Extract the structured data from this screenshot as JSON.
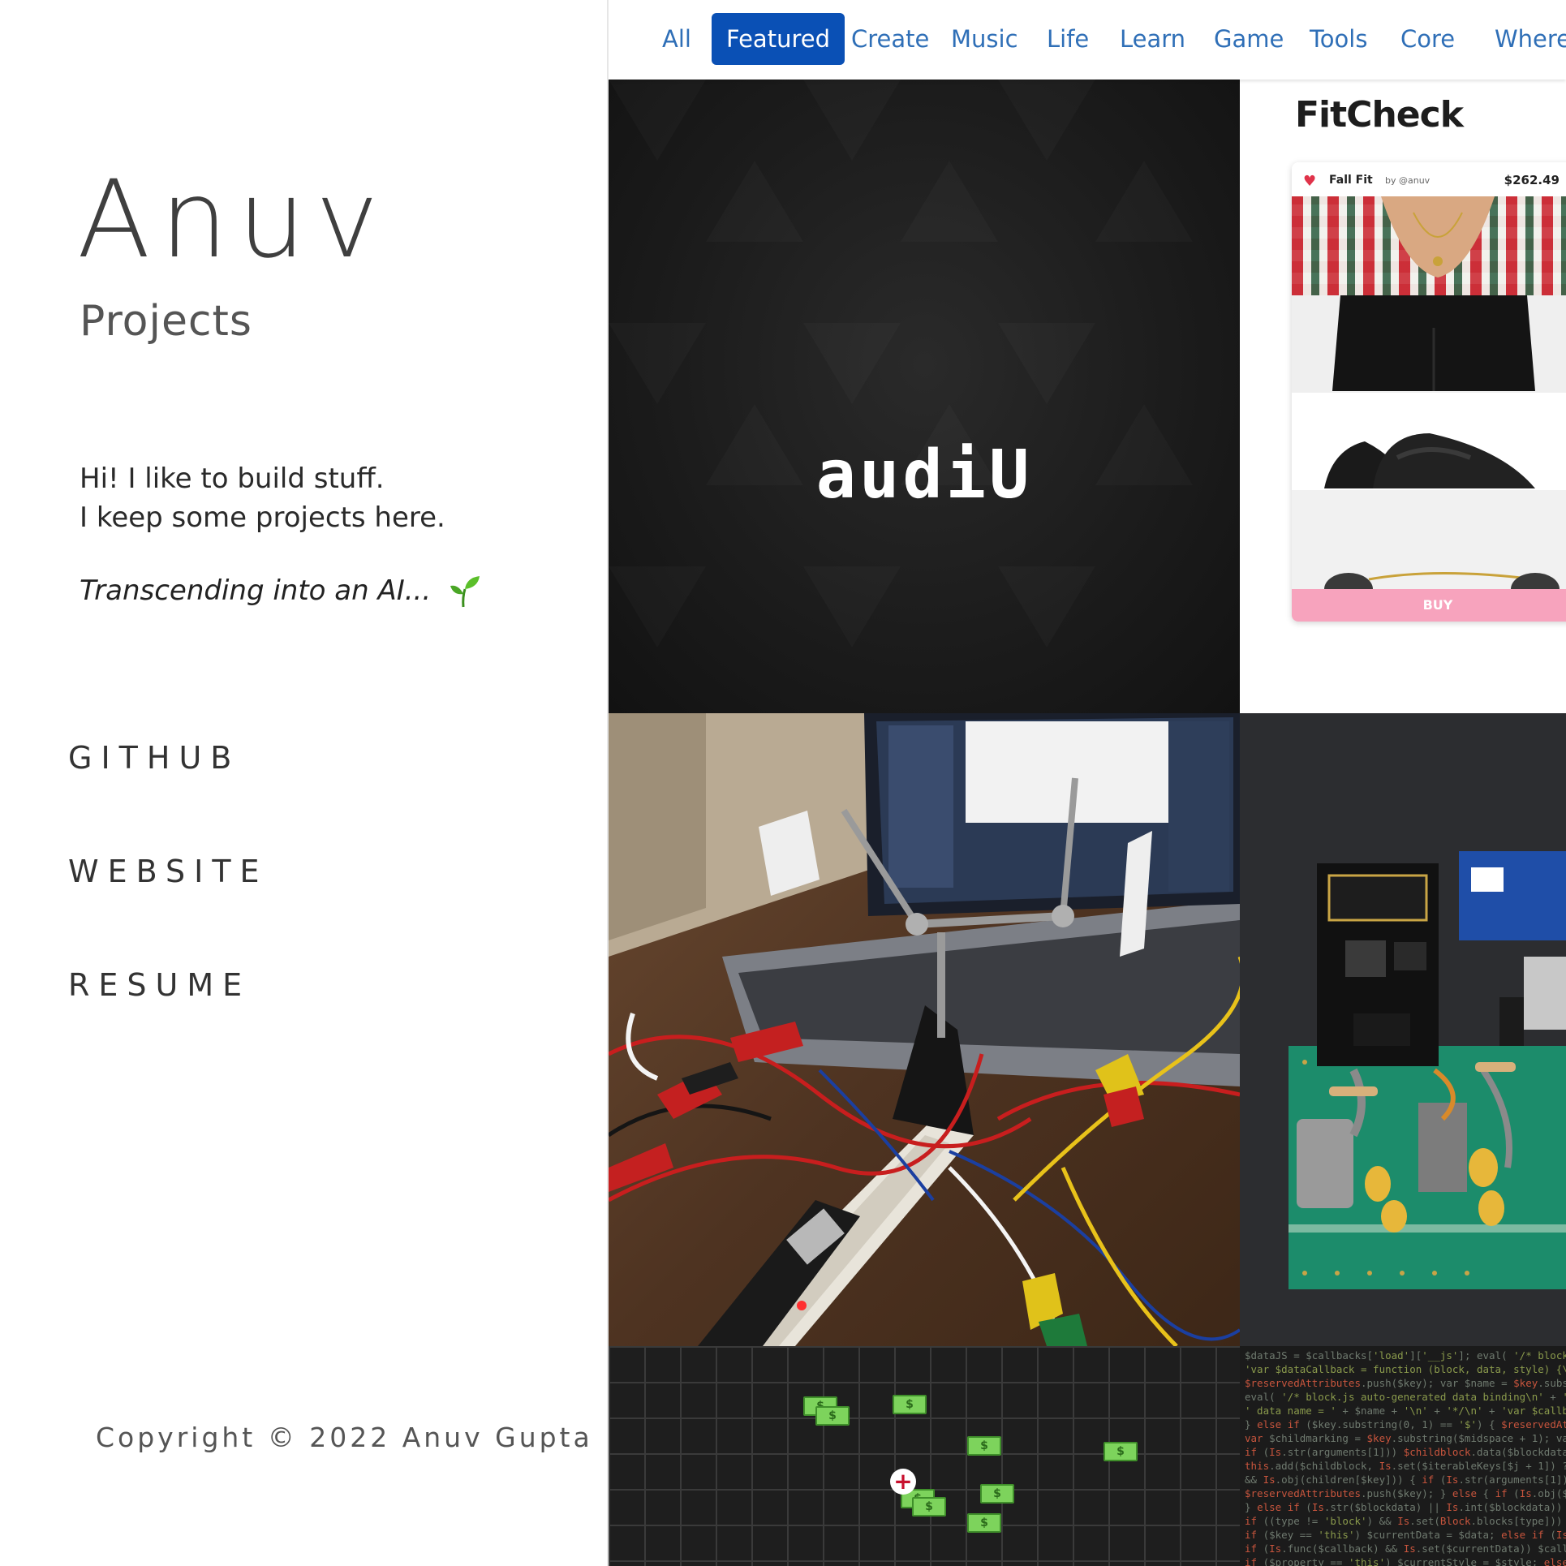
{
  "sidebar": {
    "name": "Anuv",
    "subtitle": "Projects",
    "intro_line1": "Hi! I like to build stuff.",
    "intro_line2": "I keep some projects here.",
    "tagline": "Transcending into an AI...",
    "tagline_icon": "sprout-icon",
    "links": [
      {
        "label": "GITHUB"
      },
      {
        "label": "WEBSITE"
      },
      {
        "label": "RESUME"
      }
    ],
    "copyright": "Copyright © 2022 Anuv Gupta"
  },
  "tabs": [
    {
      "label": "All",
      "active": false
    },
    {
      "label": "Featured",
      "active": true
    },
    {
      "label": "Create",
      "active": false
    },
    {
      "label": "Music",
      "active": false
    },
    {
      "label": "Life",
      "active": false
    },
    {
      "label": "Learn",
      "active": false
    },
    {
      "label": "Game",
      "active": false
    },
    {
      "label": "Tools",
      "active": false
    },
    {
      "label": "Core",
      "active": false
    },
    {
      "label": "Where",
      "active": false
    }
  ],
  "projects": {
    "audiu": {
      "logo_text": "audiU"
    },
    "fitcheck": {
      "logo_text": "FitCheck",
      "card_title": "Fall Fit",
      "card_by": "by @anuv",
      "card_price": "$262.49",
      "buy_label": "BUY"
    },
    "game": {
      "cash_symbol": "$"
    }
  },
  "colors": {
    "accent": "#0a50b5",
    "tab_text": "#2f6fb7",
    "buy_pink": "#f7a3bd",
    "cash_green": "#7dd35c"
  }
}
